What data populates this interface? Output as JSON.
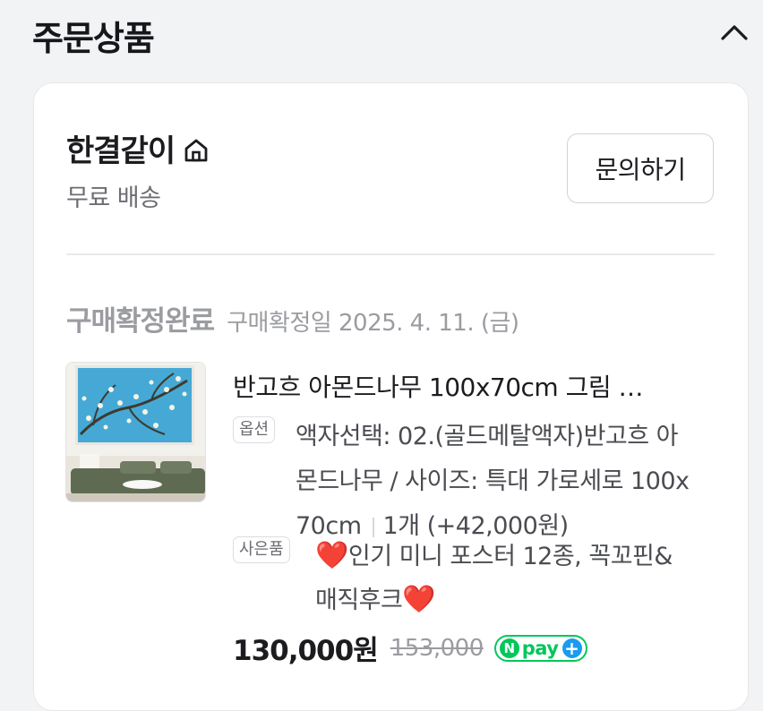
{
  "section": {
    "title": "주문상품"
  },
  "seller": {
    "name": "한결같이",
    "shipping": "무료 배송",
    "inquiry_label": "문의하기"
  },
  "order": {
    "status": "구매확정완료",
    "status_date": "구매확정일 2025. 4. 11. (금)"
  },
  "product": {
    "name": "반고흐 아몬드나무 100x70cm 그림 …",
    "option_tag": "옵션",
    "option_line1": "액자선택: 02.(골드메탈액자)반고흐 아",
    "option_line2": "몬드나무 / 사이즈: 특대 가로세로 100x",
    "option_line3": "70cm",
    "quantity": "1개 (+42,000원)",
    "gift_tag": "사은품",
    "gift_heart_1": "❤️",
    "gift_line1": "인기 미니 포스터 12종, 꼭꼬핀&",
    "gift_line2": "매직후크",
    "gift_heart_2": "❤️",
    "price": "130,000원",
    "original_price": "153,000",
    "npay": {
      "n": "N",
      "label": "pay",
      "plus": "+"
    }
  },
  "colors": {
    "background": "#f2f3f5",
    "npay_green": "#03c75a",
    "npay_plus_blue": "#1a9bf0",
    "heart_red": "#e0142b"
  },
  "icons": {
    "collapse": "chevron-up-icon",
    "seller_home": "home-icon"
  }
}
